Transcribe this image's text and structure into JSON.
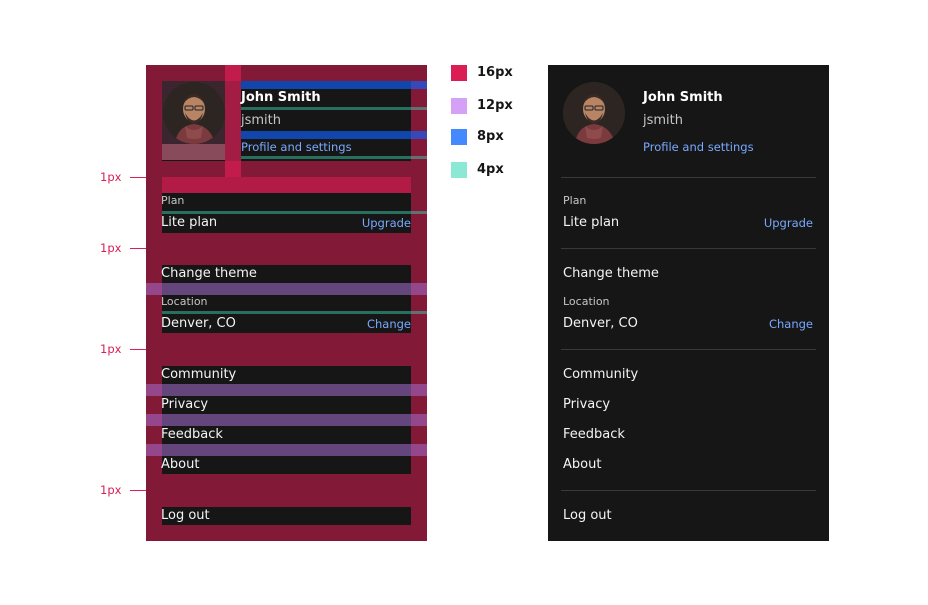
{
  "profile": {
    "name": "John Smith",
    "username": "jsmith",
    "settings_link": "Profile and settings",
    "avatar_alt": "user-avatar"
  },
  "plan": {
    "label": "Plan",
    "value": "Lite plan",
    "action": "Upgrade"
  },
  "theme": {
    "label": "Change theme"
  },
  "location": {
    "label": "Location",
    "value": "Denver, CO",
    "action": "Change"
  },
  "links": [
    "Community",
    "Privacy",
    "Feedback",
    "About"
  ],
  "logout": "Log out",
  "spacing_legend": [
    {
      "size": "16px",
      "color": "#da1e54"
    },
    {
      "size": "12px",
      "color": "#d4a1f7"
    },
    {
      "size": "8px",
      "color": "#4589ff"
    },
    {
      "size": "4px",
      "color": "#8ae8d4"
    }
  ],
  "divider_callouts": [
    "1px",
    "1px",
    "1px",
    "1px"
  ],
  "colors": {
    "panel_bg": "#161616",
    "text_primary": "#f4f4f4",
    "text_secondary": "#c6c6c6",
    "link": "#78a9ff",
    "divider": "#393939",
    "annotation": "#da1e54"
  }
}
